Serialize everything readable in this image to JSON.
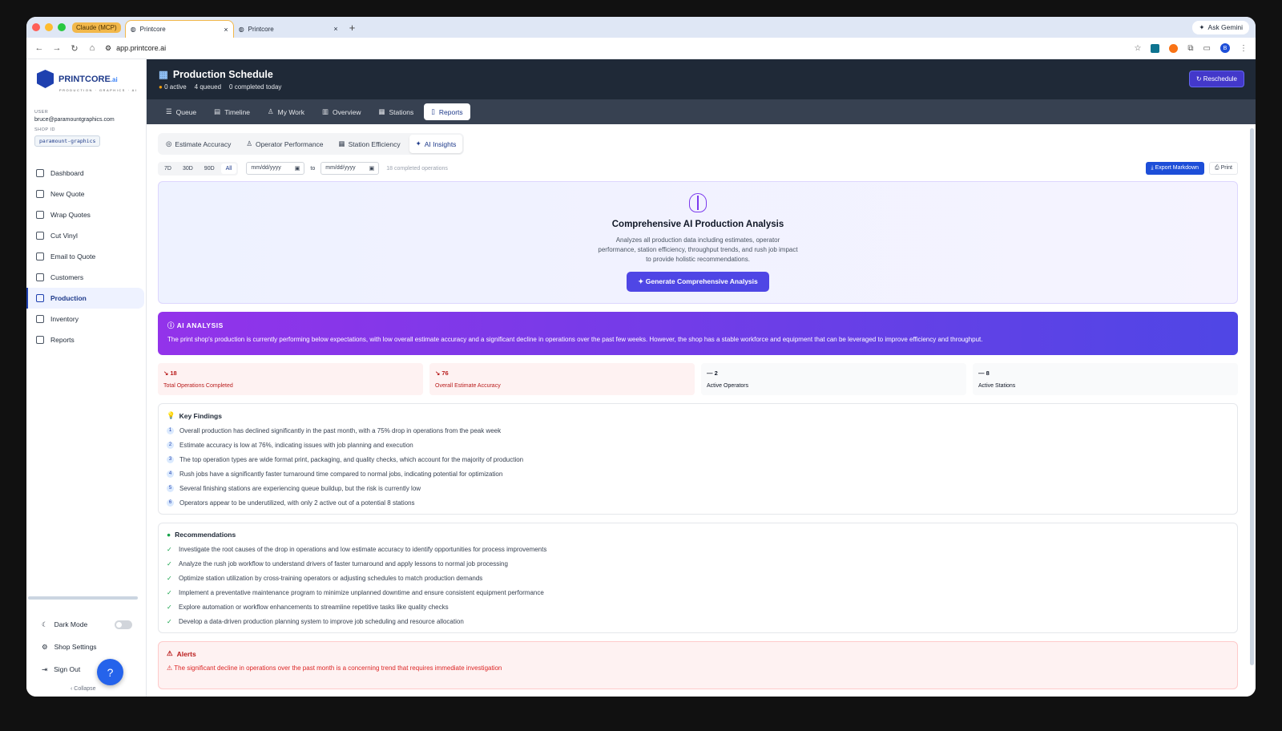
{
  "browser": {
    "tag": "Claude (MCP)",
    "tabs": [
      {
        "title": "Printcore"
      },
      {
        "title": "Printcore"
      }
    ],
    "url": "app.printcore.ai",
    "gemini": "Ask Gemini",
    "avatar": "B"
  },
  "sidebar": {
    "logo_main": "PRINTCORE",
    "logo_suffix": ".ai",
    "logo_sub": "PRODUCTION · GRAPHICS · AI",
    "user_label": "USER",
    "user_email": "bruce@paramountgraphics.com",
    "shop_label": "SHOP ID",
    "shop_id": "paramount-graphics",
    "items": [
      {
        "label": "Dashboard"
      },
      {
        "label": "New Quote"
      },
      {
        "label": "Wrap Quotes"
      },
      {
        "label": "Cut Vinyl"
      },
      {
        "label": "Email to Quote"
      },
      {
        "label": "Customers"
      },
      {
        "label": "Production"
      },
      {
        "label": "Inventory"
      },
      {
        "label": "Reports"
      }
    ],
    "dark_mode": "Dark Mode",
    "shop_settings": "Shop Settings",
    "sign_out": "Sign Out",
    "collapse": "Collapse"
  },
  "header": {
    "title": "Production Schedule",
    "active": "0 active",
    "queued": "4 queued",
    "completed": "0 completed today",
    "reschedule": "Reschedule"
  },
  "nav_tabs": [
    {
      "label": "Queue"
    },
    {
      "label": "Timeline"
    },
    {
      "label": "My Work"
    },
    {
      "label": "Overview"
    },
    {
      "label": "Stations"
    },
    {
      "label": "Reports"
    }
  ],
  "sub_tabs": [
    {
      "label": "Estimate Accuracy"
    },
    {
      "label": "Operator Performance"
    },
    {
      "label": "Station Efficiency"
    },
    {
      "label": "AI Insights"
    }
  ],
  "filters": {
    "ranges": [
      "7D",
      "30D",
      "90D",
      "All"
    ],
    "date_from": "mm/dd/yyyy",
    "to": "to",
    "date_to": "mm/dd/yyyy",
    "count": "18 completed operations",
    "export": "Export Markdown",
    "print": "Print"
  },
  "hero": {
    "title": "Comprehensive AI Production Analysis",
    "description": "Analyzes all production data including estimates, operator performance, station efficiency, throughput trends, and rush job impact to provide holistic recommendations.",
    "button": "Generate Comprehensive Analysis"
  },
  "analysis": {
    "label": "AI ANALYSIS",
    "text": "The print shop's production is currently performing below expectations, with low overall estimate accuracy and a significant decline in operations over the past few weeks. However, the shop has a stable workforce and equipment that can be leveraged to improve efficiency and throughput."
  },
  "stats": [
    {
      "value": "18",
      "label": "Total Operations Completed",
      "trend": "down"
    },
    {
      "value": "76",
      "label": "Overall Estimate Accuracy",
      "trend": "down"
    },
    {
      "value": "2",
      "label": "Active Operators",
      "trend": "flat"
    },
    {
      "value": "8",
      "label": "Active Stations",
      "trend": "flat"
    }
  ],
  "findings": {
    "title": "Key Findings",
    "items": [
      "Overall production has declined significantly in the past month, with a 75% drop in operations from the peak week",
      "Estimate accuracy is low at 76%, indicating issues with job planning and execution",
      "The top operation types are wide format print, packaging, and quality checks, which account for the majority of production",
      "Rush jobs have a significantly faster turnaround time compared to normal jobs, indicating potential for optimization",
      "Several finishing stations are experiencing queue buildup, but the risk is currently low",
      "Operators appear to be underutilized, with only 2 active out of a potential 8 stations"
    ]
  },
  "recommendations": {
    "title": "Recommendations",
    "items": [
      "Investigate the root causes of the drop in operations and low estimate accuracy to identify opportunities for process improvements",
      "Analyze the rush job workflow to understand drivers of faster turnaround and apply lessons to normal job processing",
      "Optimize station utilization by cross-training operators or adjusting schedules to match production demands",
      "Implement a preventative maintenance program to minimize unplanned downtime and ensure consistent equipment performance",
      "Explore automation or workflow enhancements to streamline repetitive tasks like quality checks",
      "Develop a data-driven production planning system to improve job scheduling and resource allocation"
    ]
  },
  "alerts": {
    "title": "Alerts",
    "text": "The significant decline in operations over the past month is a concerning trend that requires immediate investigation"
  }
}
